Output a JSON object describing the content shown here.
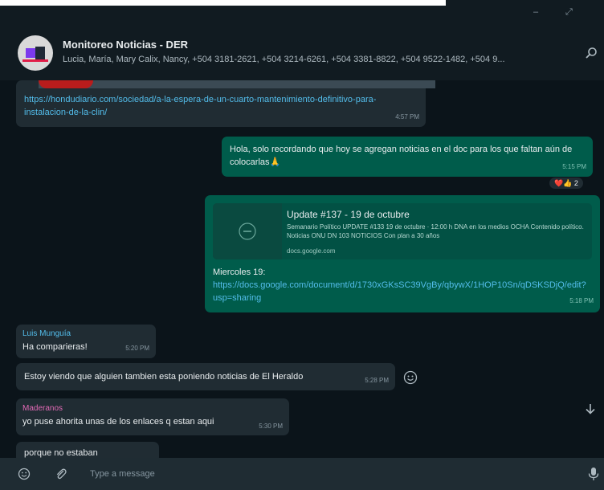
{
  "window": {
    "minimize": "–",
    "restore": "⤢"
  },
  "header": {
    "title": "Monitoreo Noticias - DER",
    "members": "Lucia, María, Mary Calix, Nancy, +504 3181-2621, +504 3214-6261, +504 3381-8822, +504 9522-1482, +504 9..."
  },
  "messages": {
    "m1": {
      "link": "https://hondudiario.com/sociedad/a-la-espera-de-un-cuarto-mantenimiento-definitivo-para-instalacion-de-la-clin/",
      "time": "4:57 PM"
    },
    "m2": {
      "text": "Hola, solo recordando que hoy se agregan noticias en el doc para los que faltan aún de colocarlas🙏",
      "time": "5:15 PM",
      "reactions": "❤️👍 2"
    },
    "m3": {
      "preview_title": "Update #137 - 19 de octubre",
      "preview_desc": "Semanario Político UPDATE #133 19 de octubre · 12:00 h DNA en los medios OCHA Contenido político. Noticias ONU DN 103 NOTICIOS Con plan a 30 años",
      "preview_domain": "docs.google.com",
      "body_line": "Miercoles 19:",
      "link": "https://docs.google.com/document/d/1730xGKsSC39VgBy/qbywX/1HOP10Sn/qDSKSDjQ/edit?usp=sharing",
      "time": "5:18 PM"
    },
    "m4": {
      "sender": "Luis Munguía",
      "text": "Ha comparieras!",
      "time": "5:20 PM"
    },
    "m5": {
      "text": "Estoy viendo que alguien tambien esta poniendo noticias de El Heraldo",
      "time": "5:28 PM"
    },
    "m6": {
      "sender": "Maderanos",
      "text": "yo puse ahorita unas de los enlaces q estan aqui",
      "time": "5:30 PM"
    },
    "m7": {
      "text": "porque no estaban"
    }
  },
  "composer": {
    "placeholder": "Type a message"
  },
  "colors": {
    "incoming": "#202c33",
    "outgoing": "#005c4b",
    "link": "#53bdeb",
    "background": "#0b141a"
  }
}
